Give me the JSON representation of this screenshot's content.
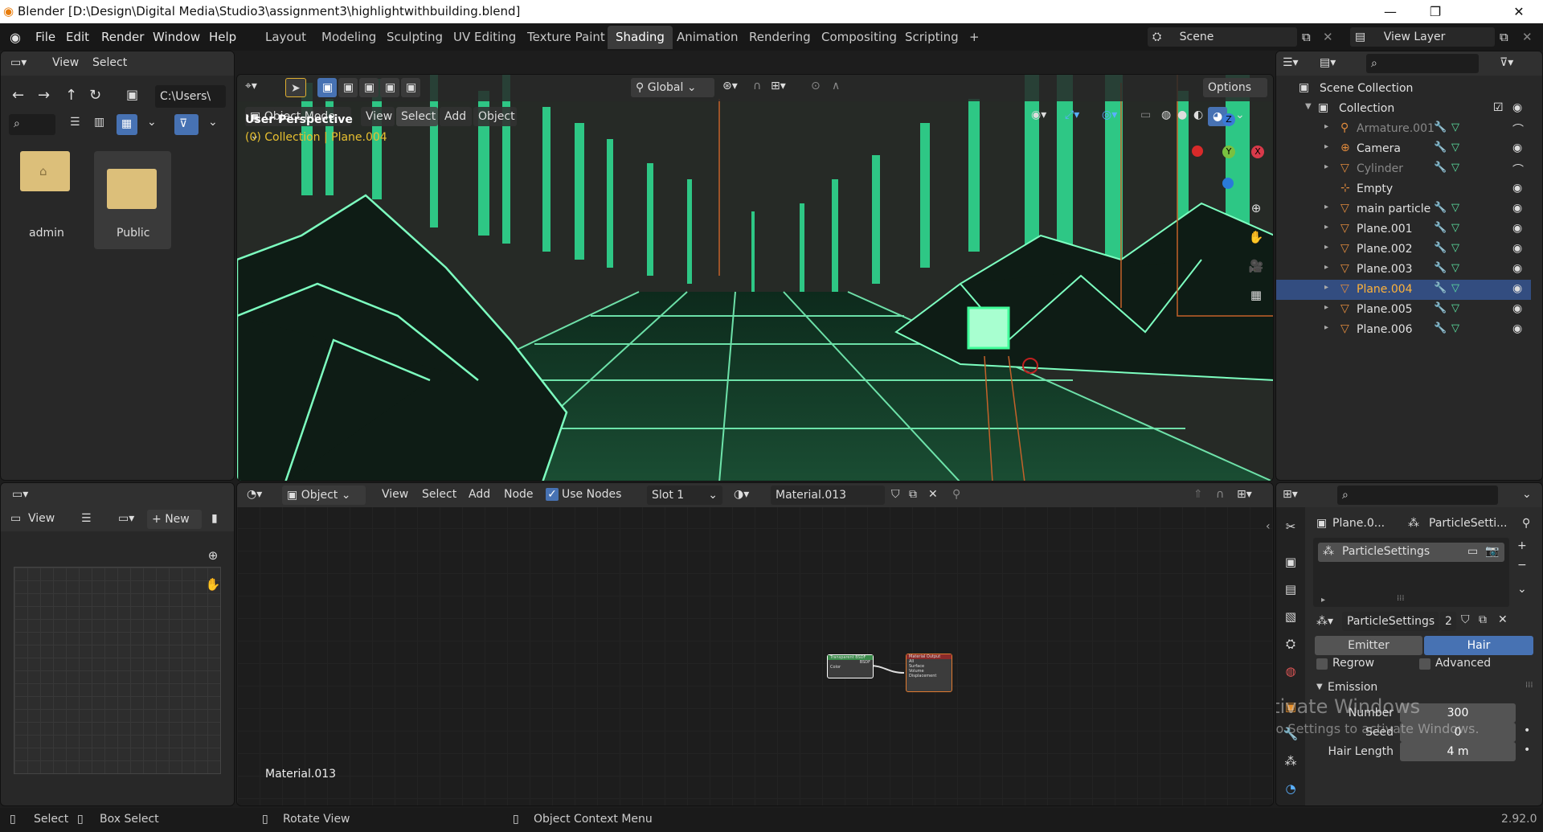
{
  "window": {
    "title": "Blender [D:\\Design\\Digital Media\\Studio3\\assignment3\\highlightwithbuilding.blend]",
    "minimize": "—",
    "maximize": "❐",
    "close": "✕"
  },
  "menu": [
    "File",
    "Edit",
    "Render",
    "Window",
    "Help"
  ],
  "workspaces": [
    "Layout",
    "Modeling",
    "Sculpting",
    "UV Editing",
    "Texture Paint",
    "Shading",
    "Animation",
    "Rendering",
    "Compositing",
    "Scripting"
  ],
  "active_workspace": "Shading",
  "scene": {
    "name": "Scene",
    "view_layer": "View Layer"
  },
  "filebrowser": {
    "menu_view": "View",
    "menu_select": "Select",
    "path": "C:\\Users\\",
    "folders": [
      "admin",
      "Public"
    ]
  },
  "viewport": {
    "mode": "Object Mode",
    "menus": [
      "View",
      "Select",
      "Add",
      "Object"
    ],
    "orientation": "Global",
    "options": "Options",
    "perspective": "User Perspective",
    "collection_info": "(0) Collection | Plane.004",
    "gizmo": {
      "z": "Z",
      "y": "Y",
      "x": "X"
    }
  },
  "outliner": {
    "root": "Scene Collection",
    "collection": "Collection",
    "items": [
      {
        "name": "Armature.001",
        "icon": "armature-icon",
        "dim": true
      },
      {
        "name": "Camera",
        "icon": "camera-icon",
        "dim": false
      },
      {
        "name": "Cylinder",
        "icon": "mesh-icon",
        "dim": true
      },
      {
        "name": "Empty",
        "icon": "empty-icon",
        "dim": false
      },
      {
        "name": "main particle",
        "icon": "mesh-icon",
        "dim": false
      },
      {
        "name": "Plane.001",
        "icon": "mesh-icon",
        "dim": false
      },
      {
        "name": "Plane.002",
        "icon": "mesh-icon",
        "dim": false
      },
      {
        "name": "Plane.003",
        "icon": "mesh-icon",
        "dim": false
      },
      {
        "name": "Plane.004",
        "icon": "mesh-icon",
        "dim": false,
        "selected": true
      },
      {
        "name": "Plane.005",
        "icon": "mesh-icon",
        "dim": false
      },
      {
        "name": "Plane.006",
        "icon": "mesh-icon",
        "dim": false
      }
    ]
  },
  "image_editor": {
    "view": "View",
    "new": "New"
  },
  "node_editor": {
    "object": "Object",
    "menus": [
      "View",
      "Select",
      "Add",
      "Node"
    ],
    "use_nodes": "Use Nodes",
    "slot": "Slot 1",
    "material": "Material.013",
    "material_label": "Material.013",
    "node1_title": "Transparent BSDF",
    "node1_output": "BSDF",
    "node1_input": "Color",
    "node2_title": "Material Output",
    "node2_target": "All",
    "node2_inputs": [
      "Surface",
      "Volume",
      "Displacement"
    ]
  },
  "properties": {
    "breadcrumb_object": "Plane.0...",
    "breadcrumb_settings": "ParticleSetti...",
    "system_name": "ParticleSettings",
    "settings_name": "ParticleSettings",
    "users": "2",
    "type_emitter": "Emitter",
    "type_hair": "Hair",
    "regrow": "Regrow",
    "advanced": "Advanced",
    "emission": "Emission",
    "number_label": "Number",
    "number": "300",
    "seed_label": "Seed",
    "seed": "0",
    "hair_length_label": "Hair Length",
    "hair_length": "4 m"
  },
  "watermark": {
    "line1": "Activate Windows",
    "line2": "Go to Settings to activate Windows."
  },
  "status": {
    "select": "Select",
    "box_select": "Box Select",
    "rotate": "Rotate View",
    "context": "Object Context Menu",
    "version": "2.92.0"
  }
}
